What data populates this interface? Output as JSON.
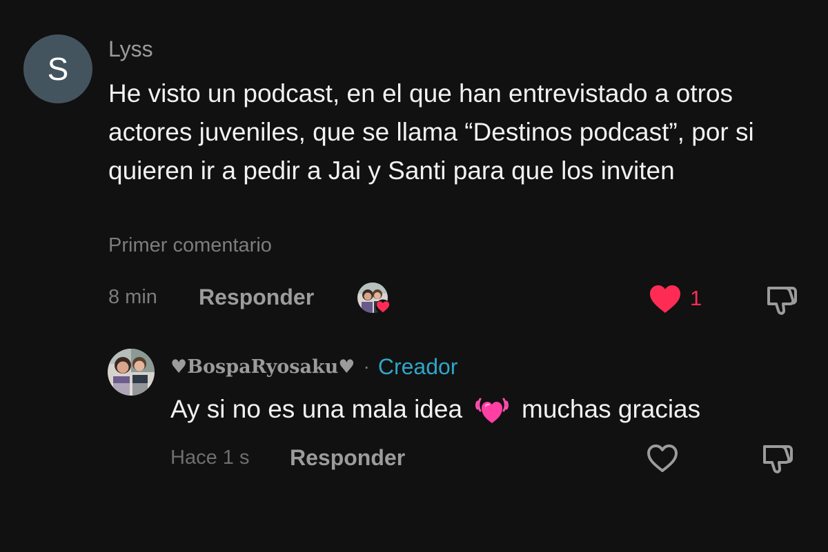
{
  "comment": {
    "avatar_letter": "S",
    "author": "Lyss",
    "text": "He visto un podcast, en el que han entrevistado a otros actores juveniles, que se llama “Destinos podcast”, por si quieren ir a pedir a Jai y Santi para que los inviten",
    "tag": "Primer comentario",
    "time": "8 min",
    "reply_label": "Responder",
    "like_count": "1",
    "liked": true,
    "liked_by_creator": true
  },
  "reply": {
    "author": "♥BospaRyosaku♥",
    "badge": "Creador",
    "separator": "·",
    "text_before": "Ay si no es una mala idea",
    "emoji": "beating-heart-emoji",
    "text_after": "muchas gracias",
    "time": "Hace 1 s",
    "reply_label": "Responder",
    "liked": false
  },
  "colors": {
    "background": "#111111",
    "like_red": "#fe2c55",
    "creator_badge": "#2fa6c8",
    "avatar_bg": "#44545f"
  }
}
